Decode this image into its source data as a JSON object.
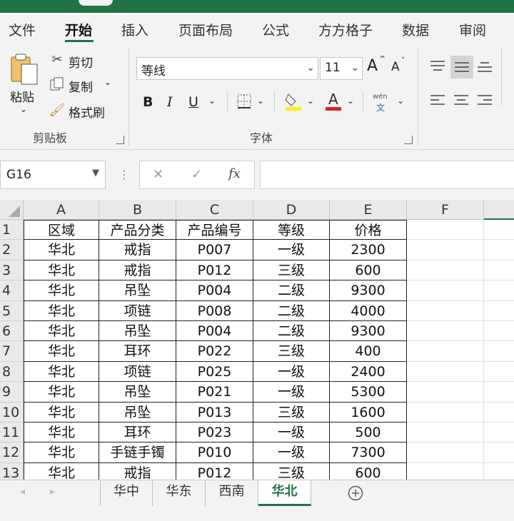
{
  "ribbon_tabs": [
    "文件",
    "开始",
    "插入",
    "页面布局",
    "公式",
    "方方格子",
    "数据",
    "审阅"
  ],
  "clipboard": {
    "paste": "粘贴",
    "cut": "剪切",
    "copy": "复制",
    "format_painter": "格式刷",
    "group_label": "剪贴板"
  },
  "font": {
    "name": "等线",
    "size": "11",
    "bold": "B",
    "italic": "I",
    "underline": "U",
    "phonetic_top": "wén",
    "phonetic_bottom": "文",
    "grow": "A",
    "shrink": "A",
    "group_label": "字体"
  },
  "formula_bar": {
    "name_box": "G16",
    "cancel": "✕",
    "enter": "✓",
    "fx": "fx",
    "content": ""
  },
  "columns": [
    "A",
    "B",
    "C",
    "D",
    "E",
    "F"
  ],
  "rows": [
    {
      "num": "1",
      "cells": [
        "区域",
        "产品分类",
        "产品编号",
        "等级",
        "价格"
      ]
    },
    {
      "num": "2",
      "cells": [
        "华北",
        "戒指",
        "P007",
        "一级",
        "2300"
      ]
    },
    {
      "num": "3",
      "cells": [
        "华北",
        "戒指",
        "P012",
        "三级",
        "600"
      ]
    },
    {
      "num": "4",
      "cells": [
        "华北",
        "吊坠",
        "P004",
        "二级",
        "9300"
      ]
    },
    {
      "num": "5",
      "cells": [
        "华北",
        "项链",
        "P008",
        "二级",
        "4000"
      ]
    },
    {
      "num": "6",
      "cells": [
        "华北",
        "吊坠",
        "P004",
        "二级",
        "9300"
      ]
    },
    {
      "num": "7",
      "cells": [
        "华北",
        "耳环",
        "P022",
        "三级",
        "400"
      ]
    },
    {
      "num": "8",
      "cells": [
        "华北",
        "项链",
        "P025",
        "一级",
        "2400"
      ]
    },
    {
      "num": "9",
      "cells": [
        "华北",
        "吊坠",
        "P021",
        "一级",
        "5300"
      ]
    },
    {
      "num": "10",
      "cells": [
        "华北",
        "吊坠",
        "P013",
        "三级",
        "1600"
      ]
    },
    {
      "num": "11",
      "cells": [
        "华北",
        "耳环",
        "P023",
        "一级",
        "500"
      ]
    },
    {
      "num": "12",
      "cells": [
        "华北",
        "手链手镯",
        "P010",
        "一级",
        "7300"
      ]
    },
    {
      "num": "13",
      "cells": [
        "华北",
        "戒指",
        "P012",
        "三级",
        "600"
      ]
    }
  ],
  "sheets": [
    "华中",
    "华东",
    "西南",
    "华北"
  ],
  "active_sheet": "华北",
  "colors": {
    "accent": "#217346",
    "font_highlight": "#ffee00",
    "font_color": "#e02020"
  }
}
